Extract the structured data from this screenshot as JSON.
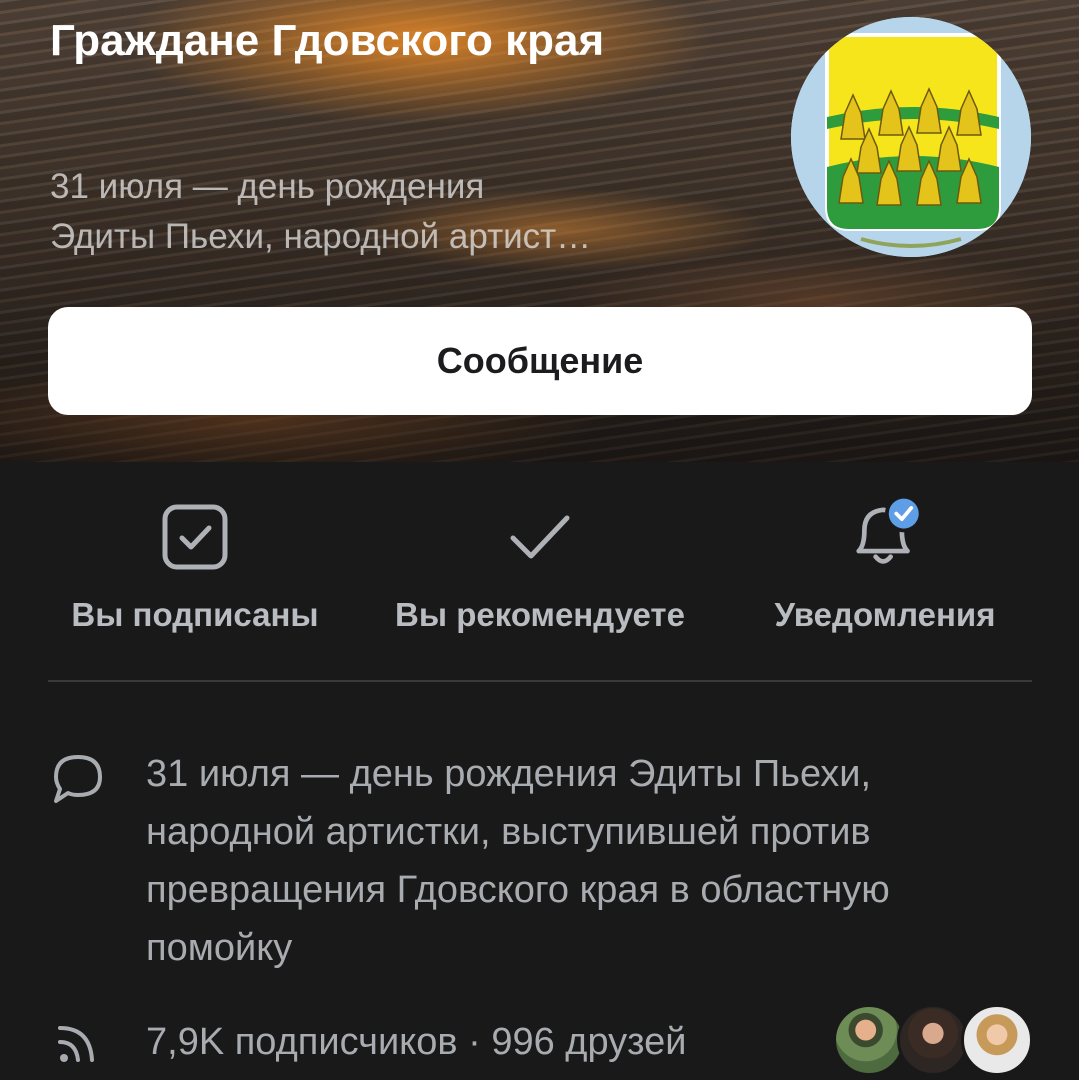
{
  "header": {
    "title": "Граждане Гдовского края",
    "status_line1": "31 июля — день рождения",
    "status_line2": "Эдиты Пьехи, народной артист…",
    "avatar": "coat-of-arms-avatar",
    "message_button": "Сообщение"
  },
  "actions": [
    {
      "label": "Вы подписаны",
      "icon": "checkbox-checked-icon"
    },
    {
      "label": "Вы рекомендуете",
      "icon": "checkmark-icon"
    },
    {
      "label": "Уведомления",
      "icon": "bell-verified-icon"
    }
  ],
  "info": {
    "status_icon": "comment-icon",
    "status_text": "31 июля — день рождения Эдиты Пьехи, народной артистки, выступившей против превращения Гдовского края в областную помойку",
    "followers_icon": "rss-icon",
    "followers_text": "7,9K подписчиков · 996 друзей"
  },
  "colors": {
    "background": "#19191a",
    "accent_blue": "#5d9ee6",
    "button_bg": "#ffffff"
  }
}
